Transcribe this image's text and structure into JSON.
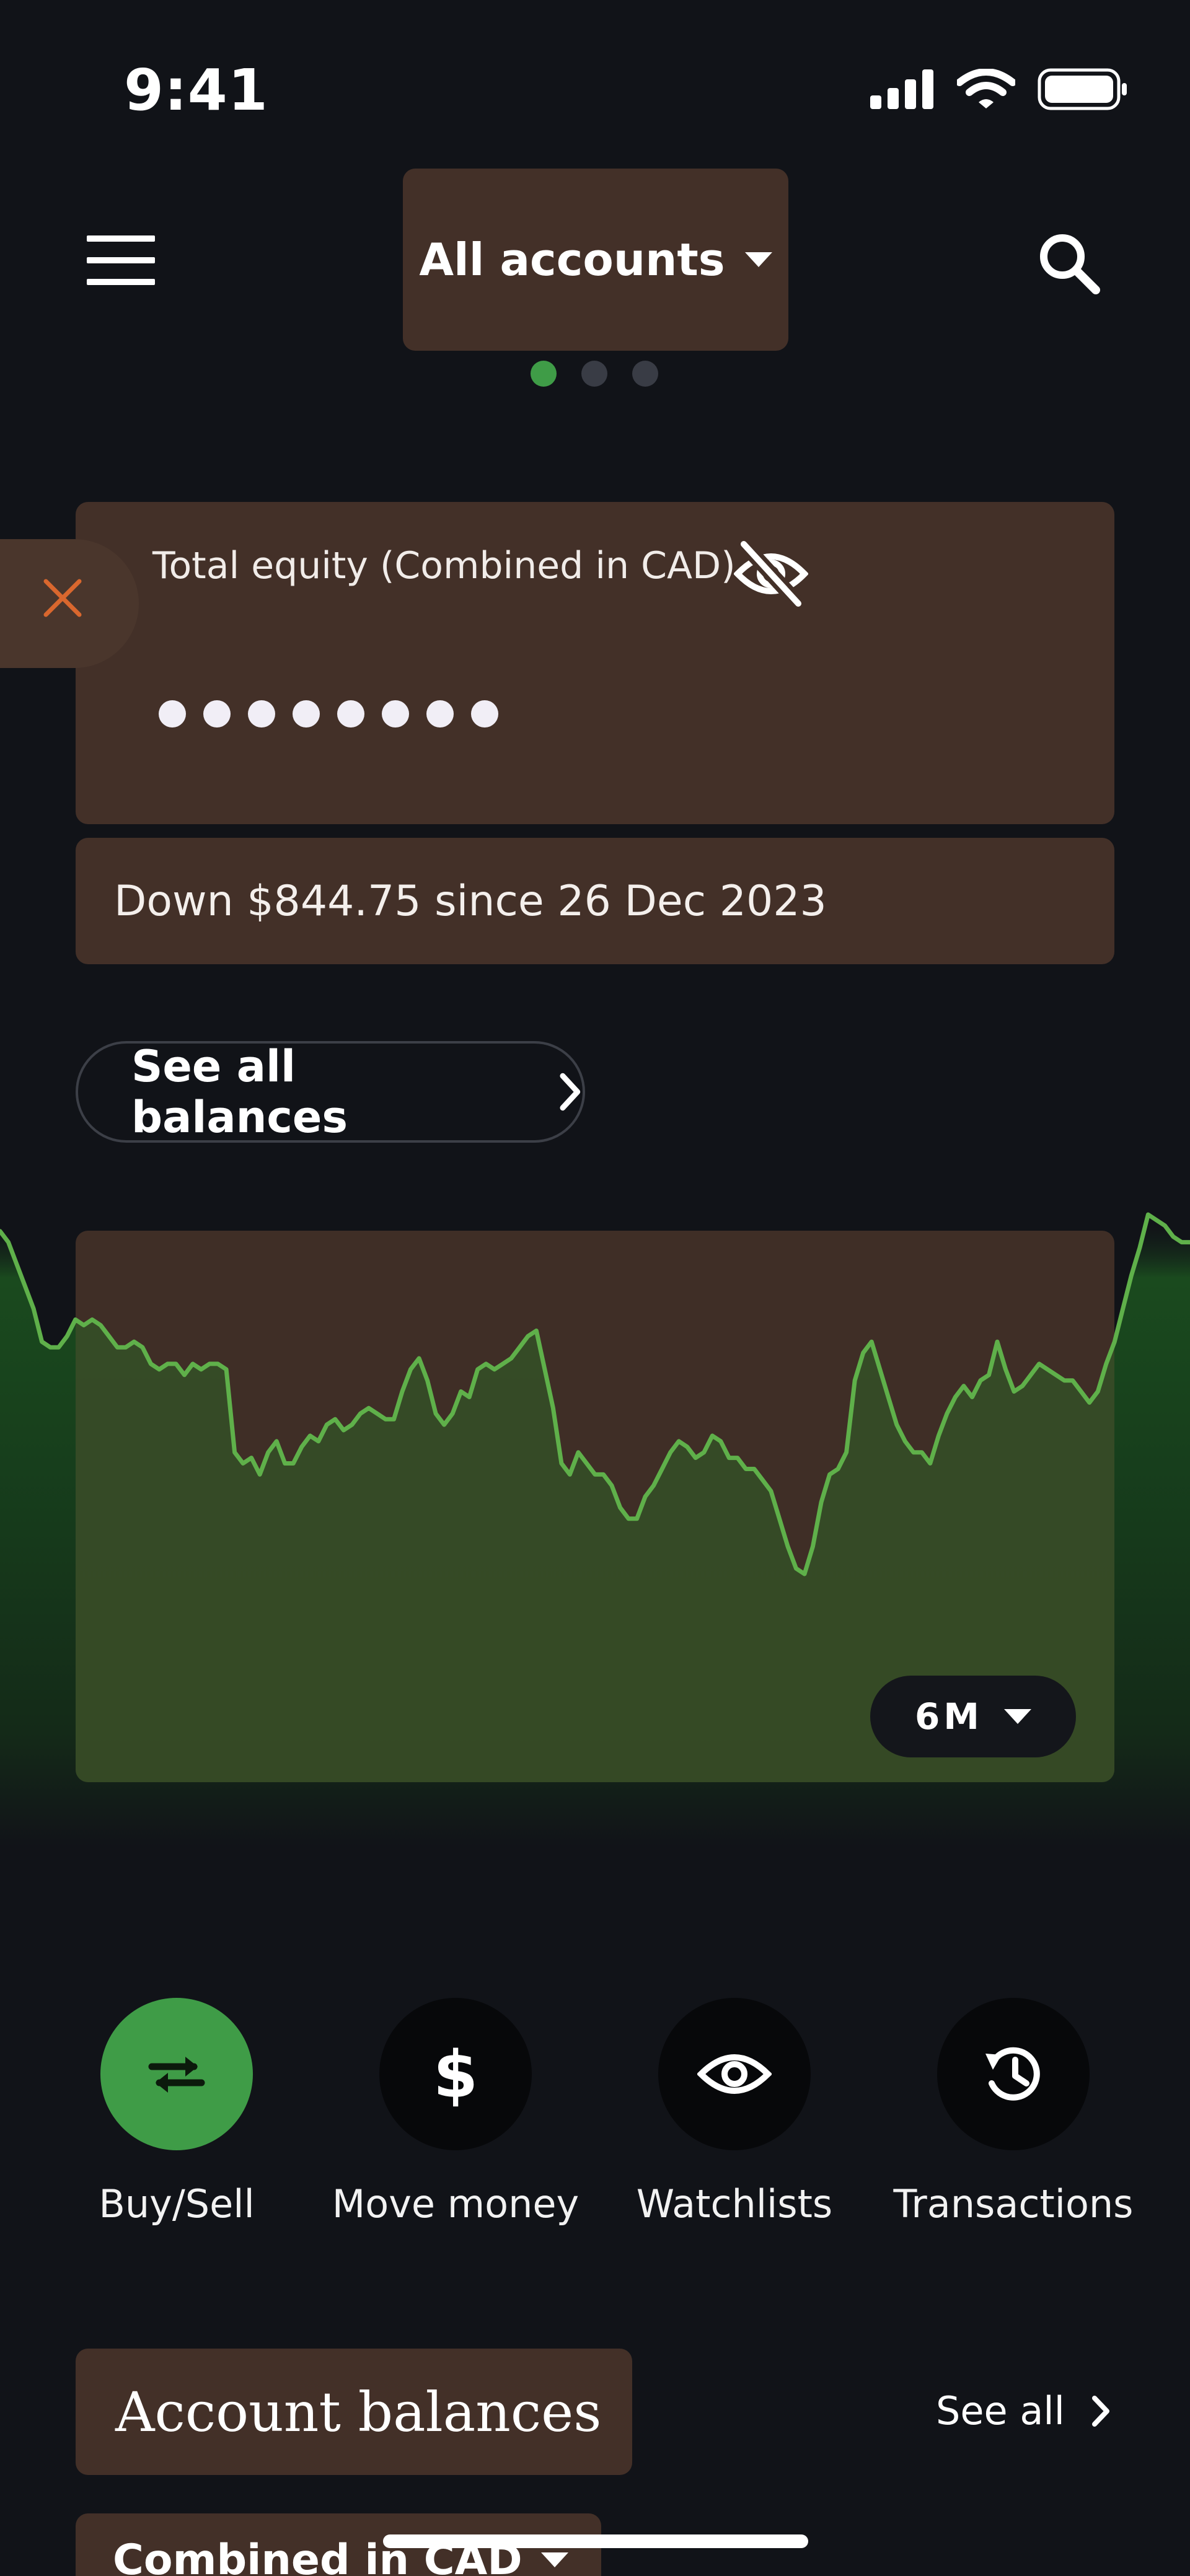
{
  "status_bar": {
    "time": "9:41",
    "icons": [
      "cellular-signal-icon",
      "wifi-icon",
      "battery-icon"
    ]
  },
  "header": {
    "menu_icon": "hamburger-menu-icon",
    "account_selector": "All accounts",
    "search_icon": "search-icon",
    "page_dots": {
      "count": 3,
      "active_index": 0
    }
  },
  "equity": {
    "label": "Total equity (Combined in CAD)",
    "visibility_icon": "eye-off-icon",
    "masked_value_dots": 8,
    "change_text": "Down $844.75 since 26 Dec 2023"
  },
  "see_all_balances": {
    "label": "See all balances"
  },
  "chart_data": {
    "type": "area",
    "title": "",
    "xlabel": "",
    "ylabel": "",
    "x_axis_visible": false,
    "y_axis_visible": false,
    "grid": false,
    "series": [
      {
        "values": [
          62,
          60,
          56,
          52,
          48,
          42,
          41,
          41,
          43,
          46,
          45,
          46,
          45,
          43,
          41,
          41,
          42,
          41,
          38,
          37,
          38,
          38,
          36,
          38,
          37,
          38,
          38,
          37,
          22,
          20,
          21,
          18,
          22,
          24,
          20,
          20,
          23,
          25,
          24,
          27,
          28,
          26,
          27,
          29,
          30,
          29,
          28,
          28,
          33,
          37,
          39,
          35,
          29,
          27,
          29,
          33,
          32,
          37,
          38,
          37,
          38,
          39,
          41,
          43,
          44,
          37,
          30,
          20,
          18,
          22,
          20,
          18,
          18,
          16,
          12,
          10,
          10,
          14,
          16,
          19,
          22,
          24,
          23,
          21,
          22,
          25,
          24,
          21,
          21,
          19,
          19,
          17,
          15,
          10,
          5,
          1,
          0,
          5,
          13,
          18,
          19,
          22,
          35,
          40,
          42,
          37,
          32,
          27,
          24,
          22,
          22,
          20,
          25,
          29,
          32,
          34,
          32,
          35,
          36,
          42,
          37,
          33,
          34,
          36,
          38,
          37,
          36,
          35,
          35,
          33,
          31,
          33,
          38,
          42,
          48,
          54,
          59,
          65,
          64,
          63,
          61,
          60,
          60
        ]
      }
    ],
    "line_color": "#5fb04a",
    "fill_color": "#2b6a25"
  },
  "period_selector": {
    "label": "6M"
  },
  "quick_actions": [
    {
      "label": "Buy/Sell",
      "icon": "swap-arrows-icon",
      "primary": true
    },
    {
      "label": "Move money",
      "icon": "dollar-icon",
      "primary": false
    },
    {
      "label": "Watchlists",
      "icon": "eye-icon",
      "primary": false
    },
    {
      "label": "Transactions",
      "icon": "history-icon",
      "primary": false
    }
  ],
  "account_balances": {
    "heading": "Account balances",
    "see_all": "See all",
    "currency_selector": "Combined in CAD"
  },
  "colors": {
    "background": "#111318",
    "card": "#433028",
    "accent_green": "#3f9c47",
    "close_orange": "#d9672e"
  }
}
